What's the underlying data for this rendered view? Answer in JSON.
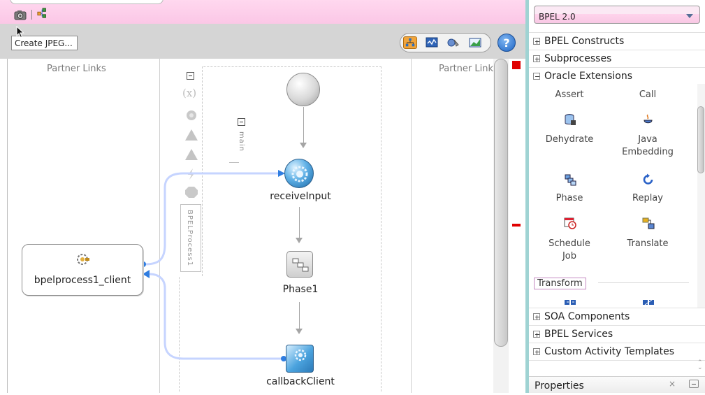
{
  "toolbar": {
    "tooltip": "Create JPEG...",
    "view_buttons": [
      "design-view-icon",
      "monitor-view-icon",
      "validate-icon",
      "chart-view-icon"
    ],
    "help_label": "?"
  },
  "canvas": {
    "partner_links_left": "Partner Links",
    "partner_links_right": "Partner Links",
    "process_scope_label": "BPELProcess1",
    "main_scope_label": "main",
    "activities": [
      {
        "name": "receiveInput"
      },
      {
        "name": "Phase1"
      },
      {
        "name": "callbackClient"
      }
    ],
    "partner_link": "bpelprocess1_client"
  },
  "palette": {
    "version_select": "BPEL 2.0",
    "sections": {
      "bpel_constructs": "BPEL Constructs",
      "subprocesses": "Subprocesses",
      "oracle_extensions": "Oracle Extensions",
      "soa_components": "SOA Components",
      "bpel_services": "BPEL Services",
      "custom_templates": "Custom Activity Templates"
    },
    "items": {
      "assert": "Assert",
      "call": "Call",
      "dehydrate": "Dehydrate",
      "java_embedding_1": "Java",
      "java_embedding_2": "Embedding",
      "phase": "Phase",
      "replay": "Replay",
      "schedule_job_1": "Schedule",
      "schedule_job_2": "Job",
      "translate": "Translate"
    },
    "transform_label": "Transform"
  },
  "properties": {
    "title": "Properties",
    "close": "×"
  },
  "colors": {
    "accent_pink": "#fbc7e6",
    "link_blue": "#c9d6ff",
    "activity_blue": "#3a8fd4",
    "error_red": "#e00000"
  }
}
